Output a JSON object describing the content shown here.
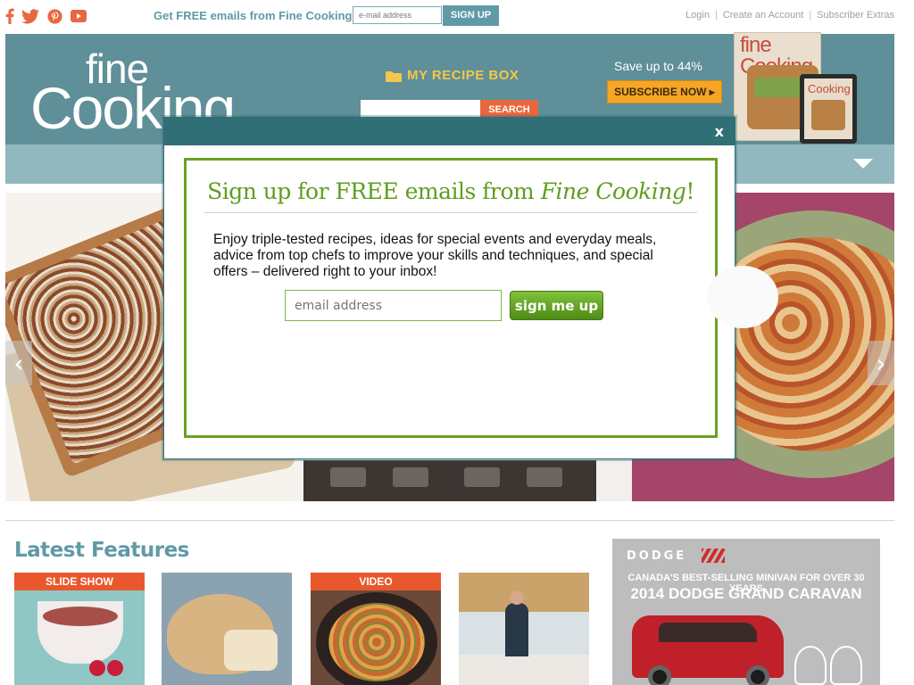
{
  "topbar": {
    "social_icons": [
      "facebook-icon",
      "twitter-icon",
      "pinterest-icon",
      "youtube-icon"
    ],
    "promo_text": "Get FREE emails from Fine Cooking",
    "email_placeholder": "e-mail address",
    "signup_label": "SIGN UP",
    "links": [
      "Login",
      "Create an Account",
      "Subscriber Extras"
    ]
  },
  "header": {
    "logo_top": "fine",
    "logo_bottom": "Cooking",
    "recipe_box_label": "MY RECIPE BOX",
    "search_label": "SEARCH",
    "save_text": "Save up to 44%",
    "subscribe_label": "SUBSCRIBE NOW ▸",
    "magazine_title": "fine Cooking",
    "tablet_title": "Cooking"
  },
  "hero": {
    "prev_arrow": "‹",
    "next_arrow": "›"
  },
  "features": {
    "title": "Latest Features",
    "cards": [
      {
        "badge": "SLIDE SHOW"
      },
      {
        "badge": ""
      },
      {
        "badge": "VIDEO"
      },
      {
        "badge": ""
      }
    ]
  },
  "ad": {
    "brand": "DODGE",
    "line1": "CANADA'S BEST-SELLING MINIVAN FOR OVER 30 YEARS",
    "line2": "2014 DODGE GRAND CARAVAN"
  },
  "modal": {
    "close_label": "x",
    "heading_pre": "Sign up for FREE emails from ",
    "heading_em": "Fine Cooking",
    "heading_post": "!",
    "body": "Enjoy triple-tested recipes, ideas for special events and everyday meals, advice from top chefs to improve your skills and techniques, and special offers – delivered right to your inbox!",
    "email_placeholder": "email address",
    "submit_label": "sign me up"
  },
  "colors": {
    "teal": "#5f9aa6",
    "header_bg": "#5f8f98",
    "accent_orange": "#e8683d",
    "green": "#6aa121"
  }
}
